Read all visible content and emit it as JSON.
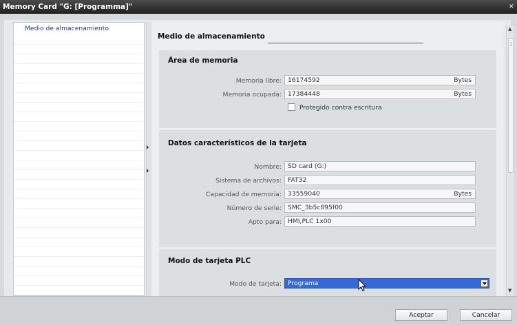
{
  "window": {
    "title": "Memory Card \"G: [Programma]\""
  },
  "nav": {
    "items": [
      {
        "label": "Medio de almacenamiento"
      }
    ]
  },
  "content": {
    "title": "Medio de almacenamiento",
    "memory": {
      "title": "Área de memoria",
      "free_label": "Memoria libre:",
      "free_value": "16174592",
      "free_unit": "Bytes",
      "used_label": "Memoria ocupada:",
      "used_value": "17384448",
      "used_unit": "Bytes",
      "write_protect_label": "Protegido contra escritura",
      "write_protect_checked": false
    },
    "card": {
      "title": "Datos característicos de la tarjeta",
      "name_label": "Nombre:",
      "name_value": "SD card (G:)",
      "fs_label": "Sistema de archivos:",
      "fs_value": "FAT32",
      "capacity_label": "Capacidad de memoria:",
      "capacity_value": "33559040",
      "capacity_unit": "Bytes",
      "serial_label": "Número de serie:",
      "serial_value": "SMC_3b5c895f00",
      "suitable_label": "Apto para:",
      "suitable_value": "HMI,PLC 1x00"
    },
    "plc_mode": {
      "title": "Modo de tarjeta PLC",
      "mode_label": "Modo de tarjeta:",
      "mode_value": "Programa"
    }
  },
  "footer": {
    "ok_label": "Aceptar",
    "cancel_label": "Cancelar"
  },
  "colors": {
    "selection": "#3569d8",
    "titlebar": "#2c2c2c"
  }
}
